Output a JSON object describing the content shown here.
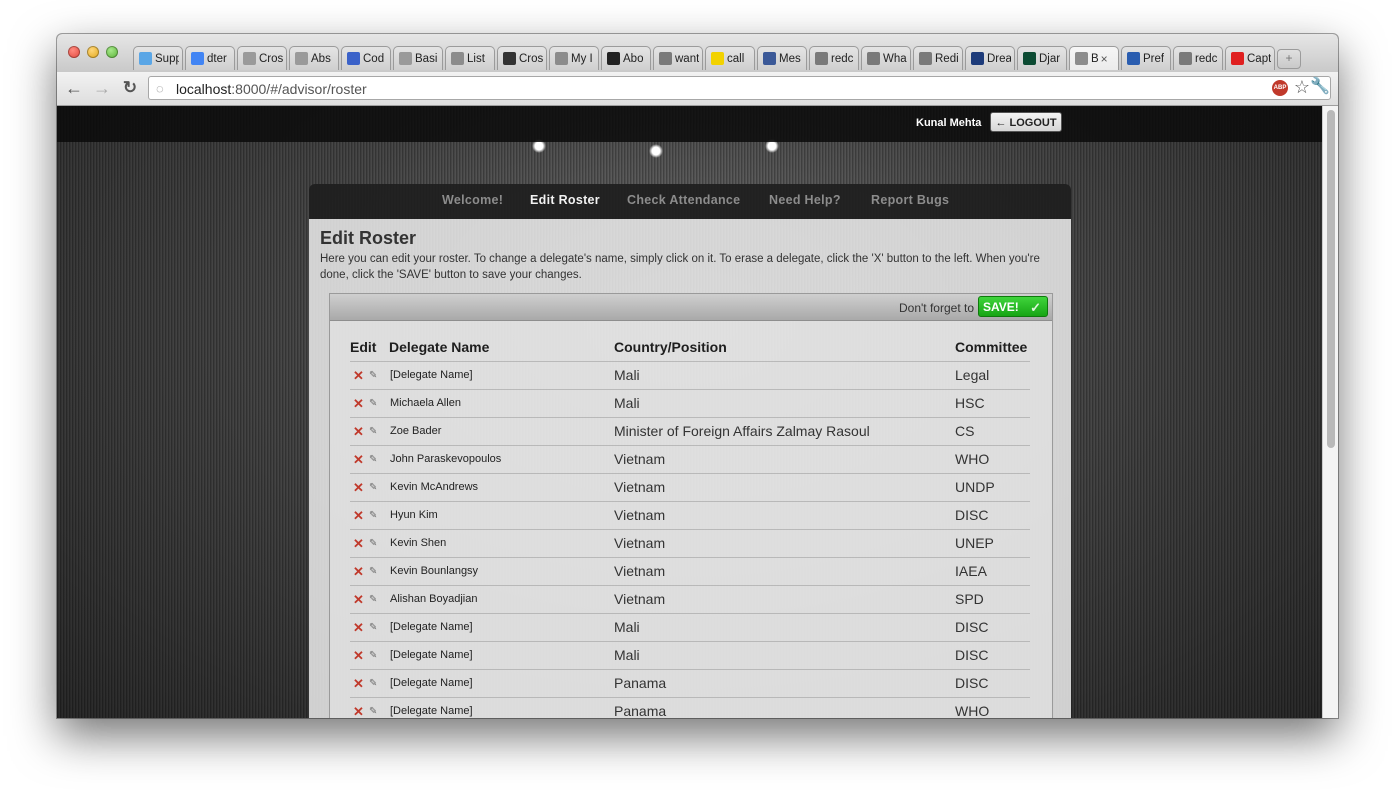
{
  "browser": {
    "tabs": [
      {
        "label": "Supp",
        "favicon_color": "#5aa6e6"
      },
      {
        "label": "dter",
        "favicon_color": "#4285f4"
      },
      {
        "label": "Cros",
        "favicon_color": "#9a9a9a"
      },
      {
        "label": "Abs",
        "favicon_color": "#9a9a9a"
      },
      {
        "label": "Cod",
        "favicon_color": "#3b62c9"
      },
      {
        "label": "Basi",
        "favicon_color": "#9a9a9a"
      },
      {
        "label": "List",
        "favicon_color": "#8c8c8c"
      },
      {
        "label": "Cros",
        "favicon_color": "#333333"
      },
      {
        "label": "My I",
        "favicon_color": "#8c8c8c"
      },
      {
        "label": "Abo",
        "favicon_color": "#222222"
      },
      {
        "label": "want",
        "favicon_color": "#7a7a7a"
      },
      {
        "label": "call",
        "favicon_color": "#f2d200"
      },
      {
        "label": "Mes",
        "favicon_color": "#3b5998"
      },
      {
        "label": "redc",
        "favicon_color": "#7a7a7a"
      },
      {
        "label": "Wha",
        "favicon_color": "#7a7a7a"
      },
      {
        "label": "Redi",
        "favicon_color": "#7a7a7a"
      },
      {
        "label": "Drea",
        "favicon_color": "#1d3b7a"
      },
      {
        "label": "Djar",
        "favicon_color": "#0c4b33"
      },
      {
        "label": "B",
        "favicon_color": "#8c8c8c",
        "active": true
      },
      {
        "label": "Pref",
        "favicon_color": "#2a5db0"
      },
      {
        "label": "redc",
        "favicon_color": "#7a7a7a"
      },
      {
        "label": "Capt",
        "favicon_color": "#e02020"
      }
    ],
    "url_host": "localhost",
    "url_path": ":8000/#/advisor/roster",
    "icons": {
      "back": "back-arrow-icon",
      "forward": "forward-arrow-icon",
      "reload": "reload-icon",
      "star": "bookmark-star-icon",
      "wrench": "wrench-icon",
      "abp": "adblock-icon"
    },
    "abp_text": "ABP"
  },
  "topbar": {
    "user_name": "Kunal Mehta",
    "logout_label": "← LOGOUT"
  },
  "nav": {
    "items": [
      {
        "label": "Welcome!",
        "active": false
      },
      {
        "label": "Edit Roster",
        "active": true
      },
      {
        "label": "Check Attendance",
        "active": false
      },
      {
        "label": "Need Help?",
        "active": false
      },
      {
        "label": "Report Bugs",
        "active": false
      }
    ]
  },
  "main": {
    "title": "Edit Roster",
    "description": "Here you can edit your roster. To change a delegate's name, simply click on it. To erase a delegate, click the 'X' button to the left. When you're done, click the 'SAVE' button to save your changes.",
    "reminder": "Don't forget to",
    "save_label": "SAVE!",
    "save_color": "#22b51f",
    "columns": [
      "Edit",
      "Delegate Name",
      "Country/Position",
      "Committee"
    ],
    "rows": [
      {
        "name": "[Delegate Name]",
        "country": "Mali",
        "committee": "Legal"
      },
      {
        "name": "Michaela Allen",
        "country": "Mali",
        "committee": "HSC"
      },
      {
        "name": "Zoe Bader",
        "country": "Minister of Foreign Affairs Zalmay Rasoul",
        "committee": "CS"
      },
      {
        "name": "John Paraskevopoulos",
        "country": "Vietnam",
        "committee": "WHO"
      },
      {
        "name": "Kevin McAndrews",
        "country": "Vietnam",
        "committee": "UNDP"
      },
      {
        "name": "Hyun Kim",
        "country": "Vietnam",
        "committee": "DISC"
      },
      {
        "name": "Kevin Shen",
        "country": "Vietnam",
        "committee": "UNEP"
      },
      {
        "name": "Kevin Bounlangsy",
        "country": "Vietnam",
        "committee": "IAEA"
      },
      {
        "name": "Alishan Boyadjian",
        "country": "Vietnam",
        "committee": "SPD"
      },
      {
        "name": "[Delegate Name]",
        "country": "Mali",
        "committee": "DISC"
      },
      {
        "name": "[Delegate Name]",
        "country": "Mali",
        "committee": "DISC"
      },
      {
        "name": "[Delegate Name]",
        "country": "Panama",
        "committee": "DISC"
      },
      {
        "name": "[Delegate Name]",
        "country": "Panama",
        "committee": "WHO"
      }
    ]
  }
}
